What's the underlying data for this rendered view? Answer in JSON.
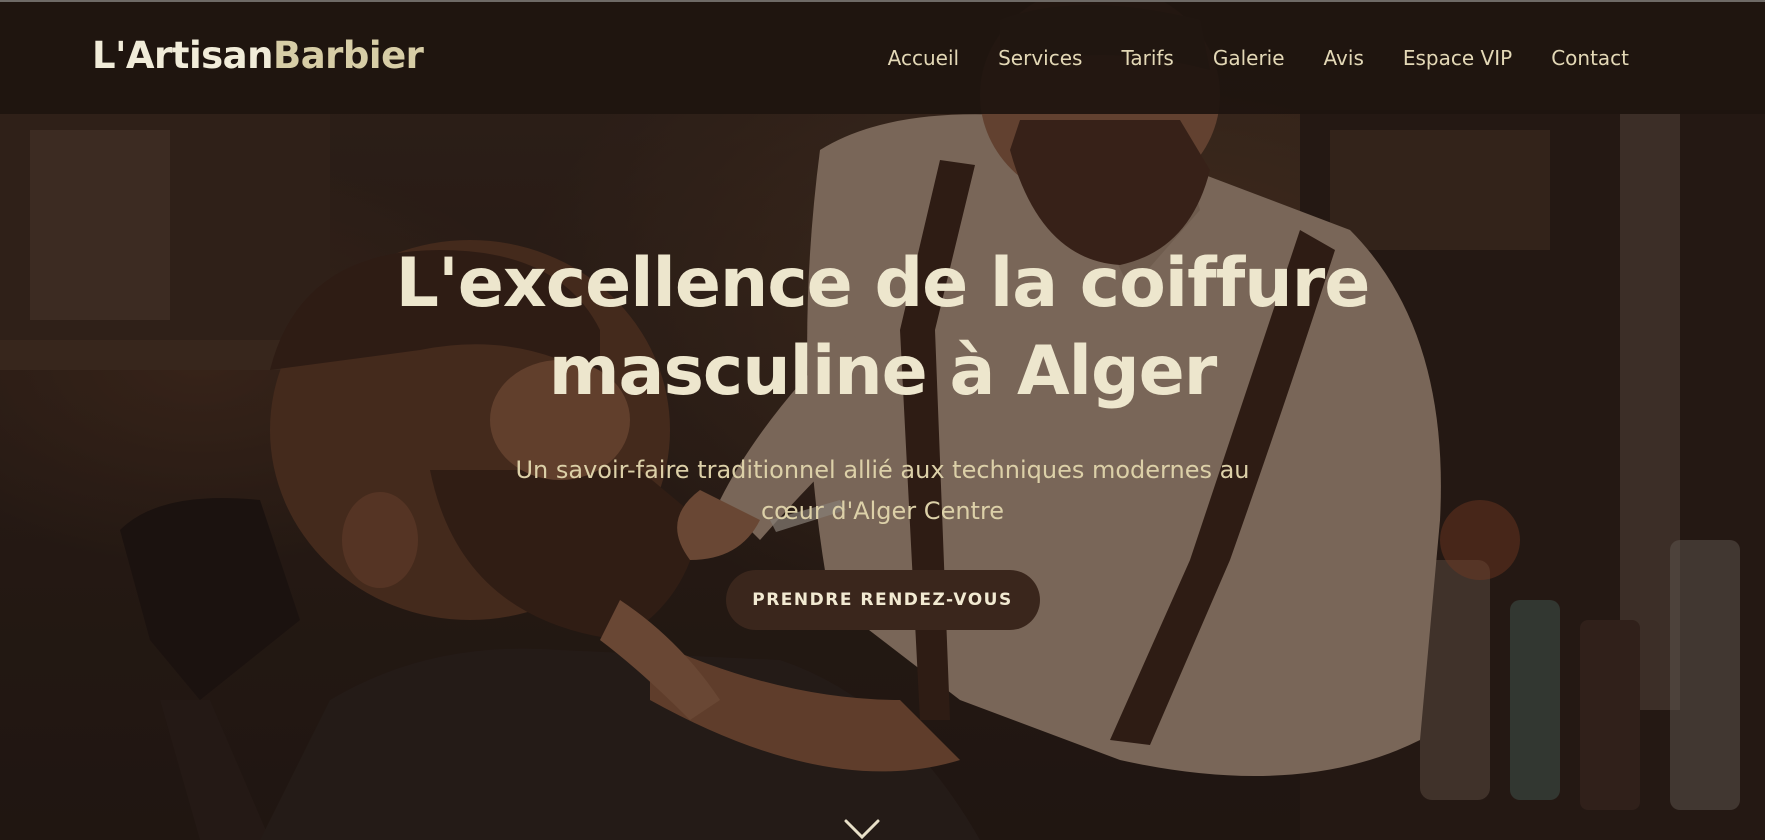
{
  "brand": {
    "name_part1": "L'Artisan",
    "name_part2": "Barbier"
  },
  "nav": {
    "items": [
      {
        "label": "Accueil"
      },
      {
        "label": "Services"
      },
      {
        "label": "Tarifs"
      },
      {
        "label": "Galerie"
      },
      {
        "label": "Avis"
      },
      {
        "label": "Espace VIP"
      },
      {
        "label": "Contact"
      }
    ]
  },
  "hero": {
    "headline": "L'excellence de la coiffure masculine à Alger",
    "subtitle": "Un savoir-faire traditionnel allié aux techniques modernes au cœur d'Alger Centre",
    "cta_label": "PRENDRE RENDEZ-VOUS",
    "scroll_icon": "chevron-down-icon"
  },
  "colors": {
    "nav_background": "#1e140f",
    "brand_light": "#f1ecd9",
    "brand_accent": "#d7cda6",
    "nav_text": "#e3d8b6",
    "headline": "#ede6cd",
    "subtitle": "#dcd0a8",
    "cta_background": "#3a261c",
    "cta_text": "#f2ead2"
  }
}
